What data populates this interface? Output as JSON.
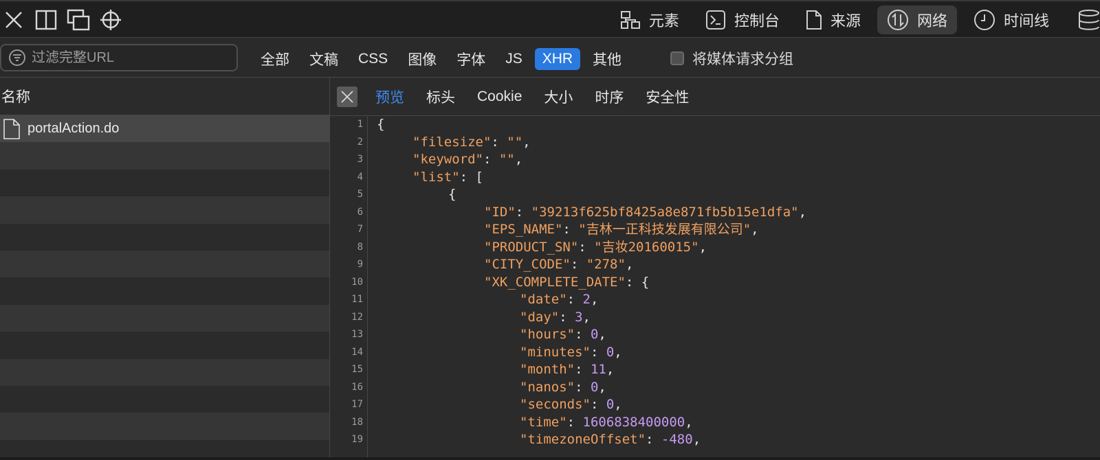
{
  "toolbar": {
    "tabs": [
      {
        "label": "元素",
        "icon": "elements-icon"
      },
      {
        "label": "控制台",
        "icon": "console-icon"
      },
      {
        "label": "来源",
        "icon": "sources-icon"
      },
      {
        "label": "网络",
        "icon": "network-icon",
        "active": true
      },
      {
        "label": "时间线",
        "icon": "timeline-icon"
      }
    ]
  },
  "filter": {
    "placeholder": "过滤完整URL",
    "types": [
      "全部",
      "文稿",
      "CSS",
      "图像",
      "字体",
      "JS",
      "XHR",
      "其他"
    ],
    "active_type": "XHR",
    "group_media_label": "将媒体请求分组"
  },
  "requests": {
    "column_name": "名称",
    "items": [
      {
        "name": "portalAction.do"
      }
    ]
  },
  "detail": {
    "tabs": [
      "预览",
      "标头",
      "Cookie",
      "大小",
      "时序",
      "安全性"
    ],
    "active_tab": "预览",
    "lines": [
      {
        "n": "1",
        "indent": 0,
        "text": "{"
      },
      {
        "n": "2",
        "indent": 1,
        "key": "filesize",
        "str": "",
        "tail": ","
      },
      {
        "n": "3",
        "indent": 1,
        "key": "keyword",
        "str": "",
        "tail": ","
      },
      {
        "n": "4",
        "indent": 1,
        "key": "list",
        "tail": ": ["
      },
      {
        "n": "5",
        "indent": 2,
        "text": "{"
      },
      {
        "n": "6",
        "indent": 3,
        "key": "ID",
        "str": "39213f625bf8425a8e871fb5b15e1dfa",
        "tail": ","
      },
      {
        "n": "7",
        "indent": 3,
        "key": "EPS_NAME",
        "str": "吉林一正科技发展有限公司",
        "tail": ","
      },
      {
        "n": "8",
        "indent": 3,
        "key": "PRODUCT_SN",
        "str": "吉妆20160015",
        "tail": ","
      },
      {
        "n": "9",
        "indent": 3,
        "key": "CITY_CODE",
        "str": "278",
        "tail": ","
      },
      {
        "n": "10",
        "indent": 3,
        "key": "XK_COMPLETE_DATE",
        "tail": ": {"
      },
      {
        "n": "11",
        "indent": 4,
        "key": "date",
        "num": "2",
        "tail": ","
      },
      {
        "n": "12",
        "indent": 4,
        "key": "day",
        "num": "3",
        "tail": ","
      },
      {
        "n": "13",
        "indent": 4,
        "key": "hours",
        "num": "0",
        "tail": ","
      },
      {
        "n": "14",
        "indent": 4,
        "key": "minutes",
        "num": "0",
        "tail": ","
      },
      {
        "n": "15",
        "indent": 4,
        "key": "month",
        "num": "11",
        "tail": ","
      },
      {
        "n": "16",
        "indent": 4,
        "key": "nanos",
        "num": "0",
        "tail": ","
      },
      {
        "n": "17",
        "indent": 4,
        "key": "seconds",
        "num": "0",
        "tail": ","
      },
      {
        "n": "18",
        "indent": 4,
        "key": "time",
        "num": "1606838400000",
        "tail": ","
      },
      {
        "n": "19",
        "indent": 4,
        "key": "timezoneOffset",
        "num": "-480",
        "tail": ","
      }
    ]
  },
  "colors": {
    "accent": "#2a7ae0",
    "active_tab_text": "#3e8df2",
    "json_key": "#f0a060",
    "json_number": "#c79bf2"
  }
}
